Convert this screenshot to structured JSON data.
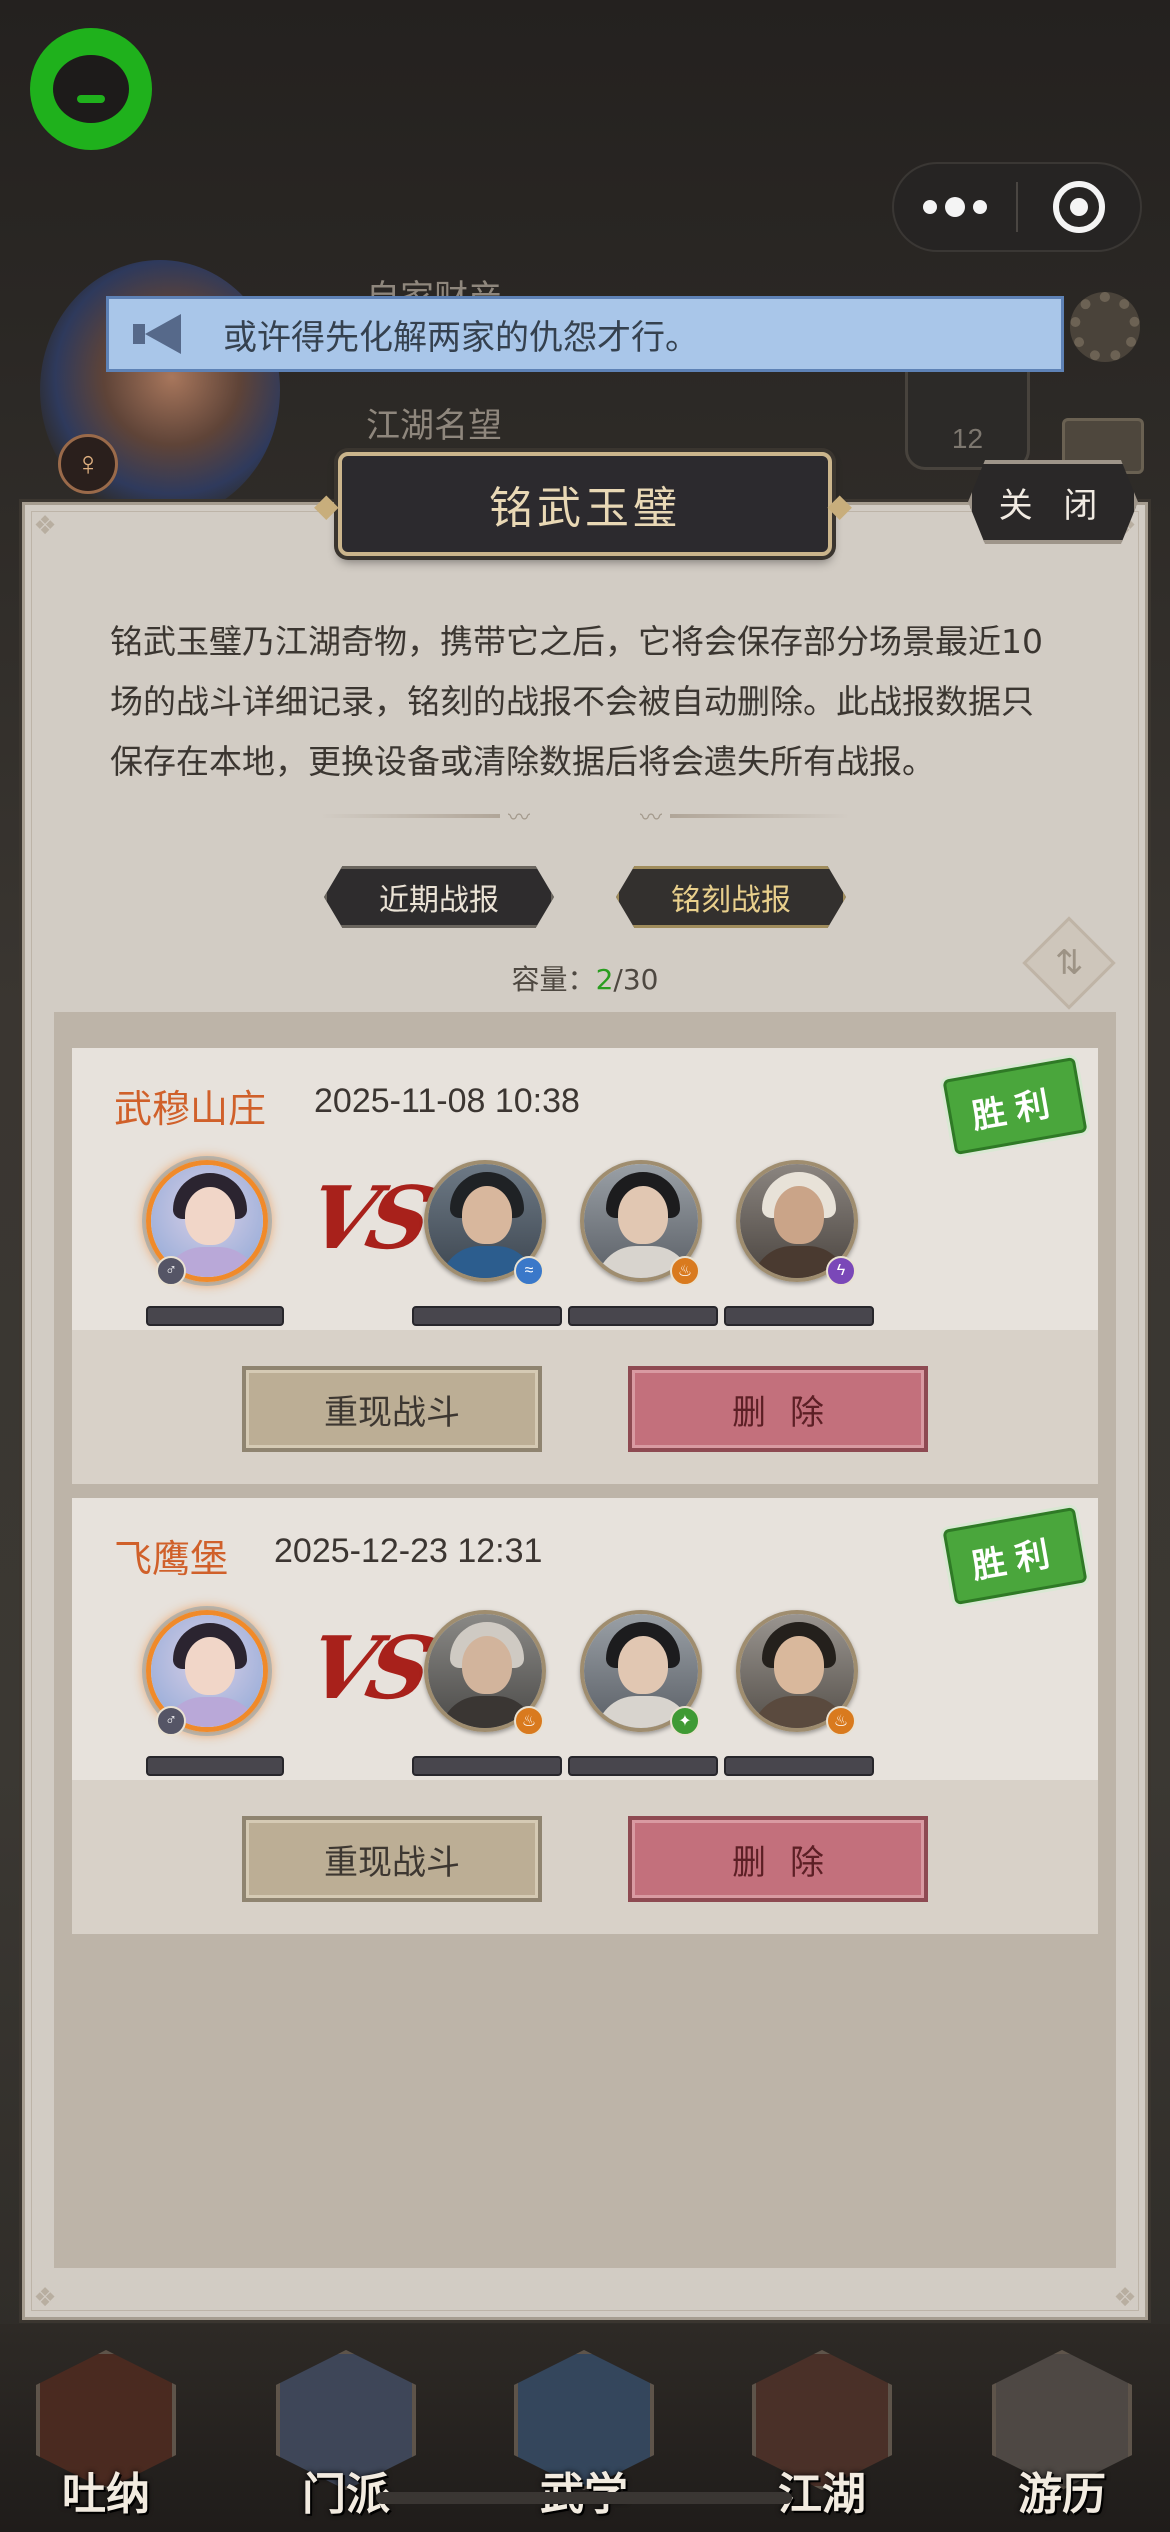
{
  "notice": {
    "text": "或许得先化解两家的仇怨才行。"
  },
  "background": {
    "label_wealth": "自家财产",
    "label_fame": "江湖名望",
    "badge_number": "12",
    "gender_symbol": "♀"
  },
  "panel": {
    "title": "铭武玉璧",
    "close_label": "关 闭",
    "description": "铭武玉璧乃江湖奇物，携带它之后，它将会保存部分场景最近10场的战斗详细记录，铭刻的战报不会被自动删除。此战报数据只保存在本地，更换设备或清除数据后将会遗失所有战报。",
    "tabs": [
      {
        "label": "近期战报",
        "active": false
      },
      {
        "label": "铭刻战报",
        "active": true
      }
    ],
    "capacity": {
      "label": "容量：",
      "used": "2",
      "total": "/30"
    }
  },
  "battles": [
    {
      "location": "武穆山庄",
      "datetime": "2025-11-08 10:38",
      "result": "胜利",
      "vs": "VS",
      "player_gender": "♂",
      "enemy_elements": [
        "water",
        "fire",
        "thunder"
      ],
      "replay_label": "重现战斗",
      "delete_label": "删除"
    },
    {
      "location": "飞鹰堡",
      "datetime": "2025-12-23 12:31",
      "result": "胜利",
      "vs": "VS",
      "player_gender": "♂",
      "enemy_elements": [
        "fire",
        "wood",
        "fire"
      ],
      "replay_label": "重现战斗",
      "delete_label": "删除"
    }
  ],
  "bottom_nav": [
    {
      "label": "吐纳",
      "icon": "meditation-icon"
    },
    {
      "label": "门派",
      "icon": "sect-icon"
    },
    {
      "label": "武学",
      "icon": "martial-arts-icon"
    },
    {
      "label": "江湖",
      "icon": "jianghu-icon"
    },
    {
      "label": "游历",
      "icon": "travel-icon"
    }
  ],
  "colors": {
    "location_text": "#d0602a",
    "victory_stamp": "#4aa63c",
    "capacity_used": "#2a9d20",
    "delete_button": "#c3707c",
    "notice_bg": "#a9c6e9"
  }
}
